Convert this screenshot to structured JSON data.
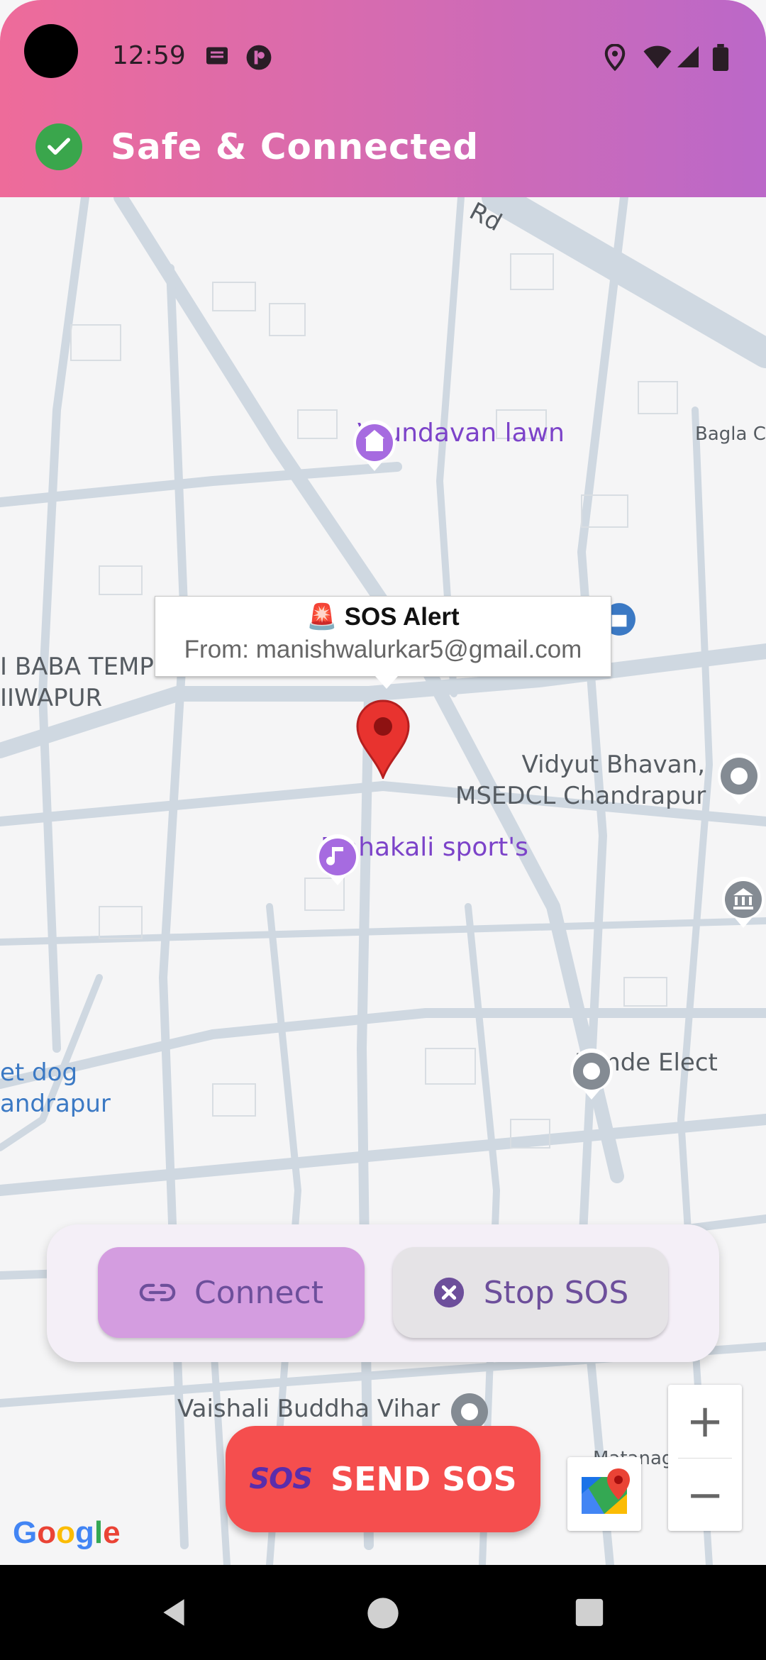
{
  "status_bar": {
    "time": "12:59",
    "left_icons": [
      "message-icon",
      "app-icon"
    ],
    "right_icons": [
      "location-icon",
      "wifi-icon",
      "signal-icon",
      "battery-icon"
    ]
  },
  "header": {
    "status_text": "Safe & Connected",
    "status_icon": "check-circle-icon",
    "gradient_start": "#ee6b9a",
    "gradient_end": "#bb68c8"
  },
  "map": {
    "road_partial": "Rd",
    "labels": {
      "bagla": "Bagla Ch",
      "baba_1": "I BABA TEMP",
      "baba_2": "IIWAPUR",
      "vidyut_1": "Vidyut Bhavan,",
      "vidyut_2": "MSEDCL Chandrapur",
      "jumde": "Jumde Elect",
      "dog_1": "et dog",
      "dog_2": "andrapur",
      "vaishali": "Vaishali Buddha Vihar",
      "matanagar": "Matanagar Rd"
    },
    "pois": {
      "vrundavan": "Vrundavan lawn",
      "mahakali": "Mahakali sport's"
    },
    "info_window": {
      "title": "🚨 SOS Alert",
      "subtitle": "From: manishwalurkar5@gmail.com"
    },
    "zoom_in": "+",
    "zoom_out": "−",
    "google_logo": "Google"
  },
  "actions": {
    "connect_label": "Connect",
    "stop_label": "Stop SOS",
    "sos_badge": "SOS",
    "sos_label": "SEND SOS",
    "sos_color": "#f54e4e"
  }
}
